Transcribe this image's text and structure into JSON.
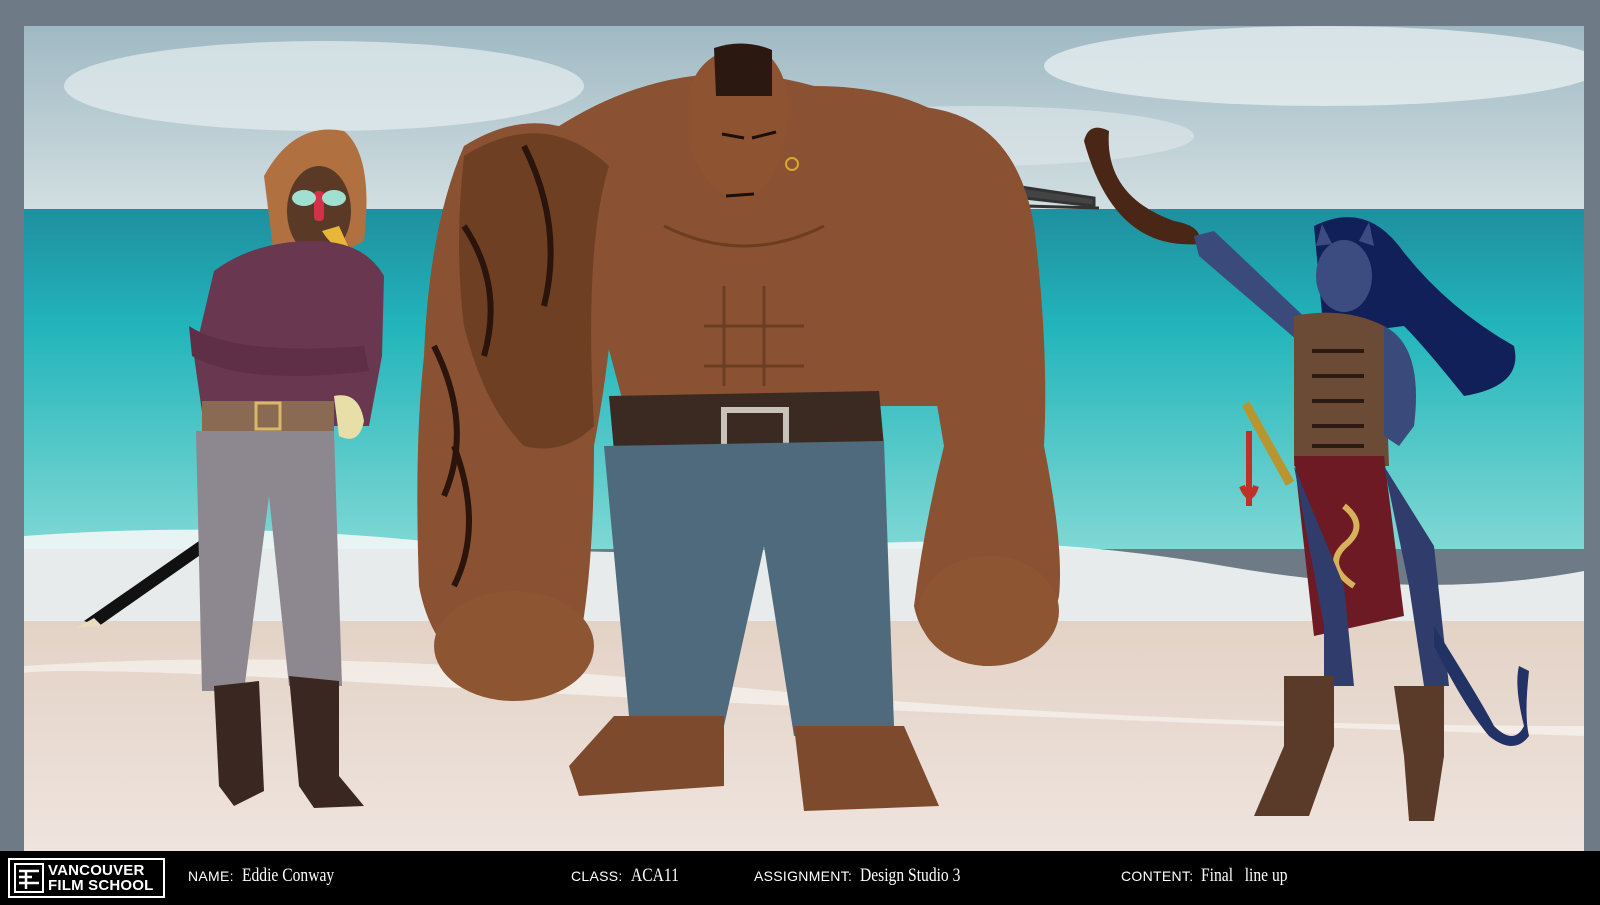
{
  "footer": {
    "logo_line1": "VANCOUVER",
    "logo_line2": "FILM SCHOOL",
    "name_label": "NAME:",
    "name_value": "Eddie Conway",
    "class_label": "CLASS:",
    "class_value": "ACA11",
    "assignment_label": "ASSIGNMENT:",
    "assignment_value": "Design Studio 3",
    "content_label": "CONTENT:",
    "content_value": "Final   line up"
  },
  "colors": {
    "frame": "#6e7a86",
    "sky": "#b9ccd4",
    "ocean": "#20b3b8",
    "sand": "#e9ddd5",
    "footer": "#000000"
  },
  "icons": {
    "logo": "vfs-logo-icon"
  }
}
